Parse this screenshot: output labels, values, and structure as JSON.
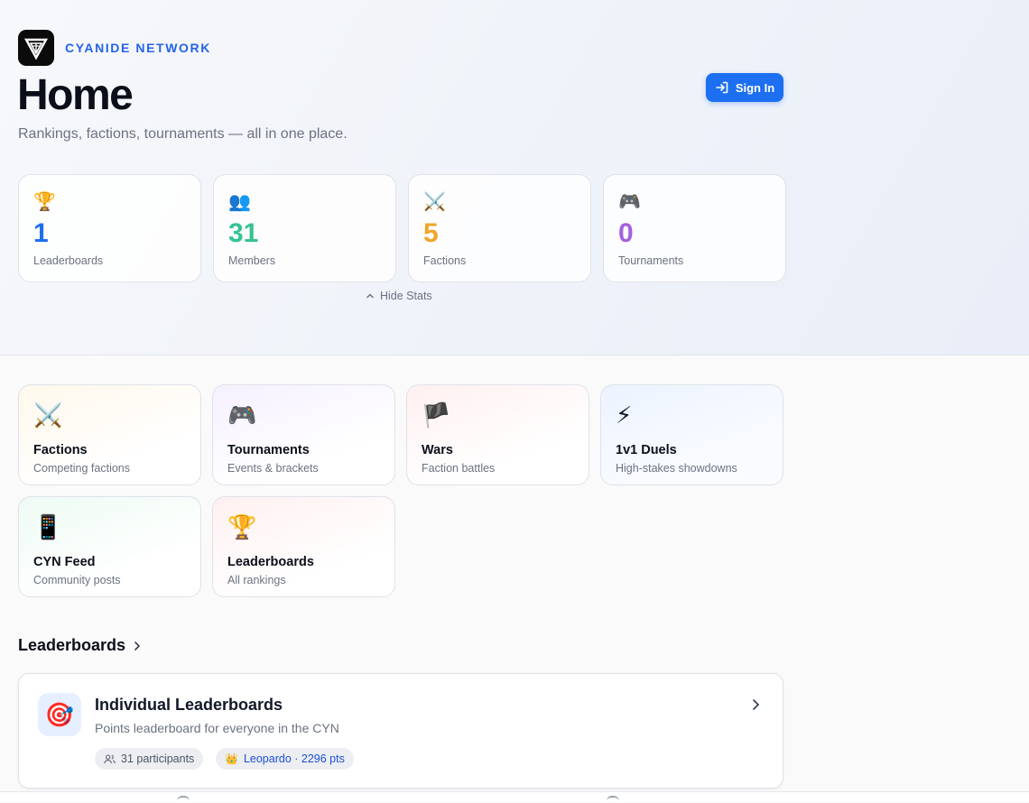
{
  "brand": {
    "name": "CYANIDE NETWORK",
    "logo_icon": "network-logo-icon"
  },
  "header": {
    "title": "Home",
    "subtitle": "Rankings, factions, tournaments — all in one place.",
    "signin_label": "Sign In"
  },
  "stats": [
    {
      "icon": "🏆",
      "value": "1",
      "label": "Leaderboards",
      "color": "#1d6ff2"
    },
    {
      "icon": "👥",
      "value": "31",
      "label": "Members",
      "color": "#34c38f"
    },
    {
      "icon": "⚔️",
      "value": "5",
      "label": "Factions",
      "color": "#f0a52a"
    },
    {
      "icon": "🎮",
      "value": "0",
      "label": "Tournaments",
      "color": "#a35fe0"
    }
  ],
  "hide_stats_label": "Hide Stats",
  "features": [
    {
      "icon": "⚔️",
      "title": "Factions",
      "desc": "Competing factions"
    },
    {
      "icon": "🎮",
      "title": "Tournaments",
      "desc": "Events & brackets"
    },
    {
      "icon": "🏴",
      "title": "Wars",
      "desc": "Faction battles"
    },
    {
      "icon": "⚡",
      "title": "1v1 Duels",
      "desc": "High-stakes showdowns"
    },
    {
      "icon": "📱",
      "title": "CYN Feed",
      "desc": "Community posts"
    },
    {
      "icon": "🏆",
      "title": "Leaderboards",
      "desc": "All rankings"
    }
  ],
  "leaderboards_section": {
    "title": "Leaderboards",
    "card": {
      "icon": "🎯",
      "title": "Individual Leaderboards",
      "desc": "Points leaderboard for everyone in the CYN",
      "participants": "31 participants",
      "leader_icon": "👑",
      "leader": "Leopardo · 2296 pts"
    }
  }
}
